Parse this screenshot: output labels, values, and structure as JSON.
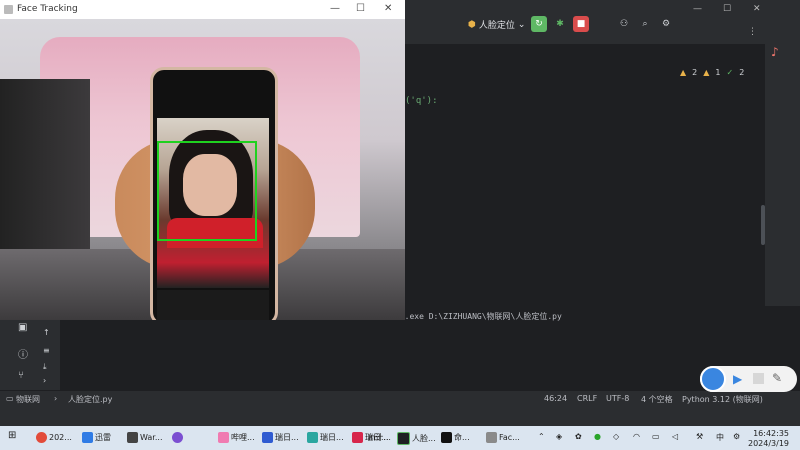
{
  "face_window": {
    "title": "Face Tracking",
    "controls": {
      "min": "—",
      "max": "☐",
      "close": "✕"
    }
  },
  "ide": {
    "run_config": "人脸定位",
    "code_visible": "('q'):",
    "inspections": {
      "warnings": "2",
      "weak": "1",
      "ok": "2"
    },
    "run_output": "on.exe D:\\ZIZHUANG\\物联网\\人脸定位.py",
    "breadcrumb": {
      "project": "物联网",
      "file": "人脸定位.py"
    },
    "status": {
      "position": "46:24",
      "line_sep": "CRLF",
      "encoding": "UTF-8",
      "indent": "4 个空格",
      "interpreter": "Python 3.12 (物联网)"
    }
  },
  "taskbar": {
    "items": [
      {
        "label": "202..."
      },
      {
        "label": "迅雷"
      },
      {
        "label": "War..."
      },
      {
        "label": ""
      },
      {
        "label": "哔哩..."
      },
      {
        "label": "瑞日..."
      },
      {
        "label": "瑞日..."
      },
      {
        "label": "瑞日..."
      },
      {
        "label": "in计..."
      },
      {
        "label": "人脸..."
      },
      {
        "label": "命..."
      },
      {
        "label": "Fac..."
      }
    ],
    "ime": "中",
    "time": "16:42:35",
    "date": "2024/3/19"
  },
  "colors": {
    "accent": "#3a86e0",
    "detection_box": "#1fd11f",
    "ide_bg": "#1e1f22"
  }
}
